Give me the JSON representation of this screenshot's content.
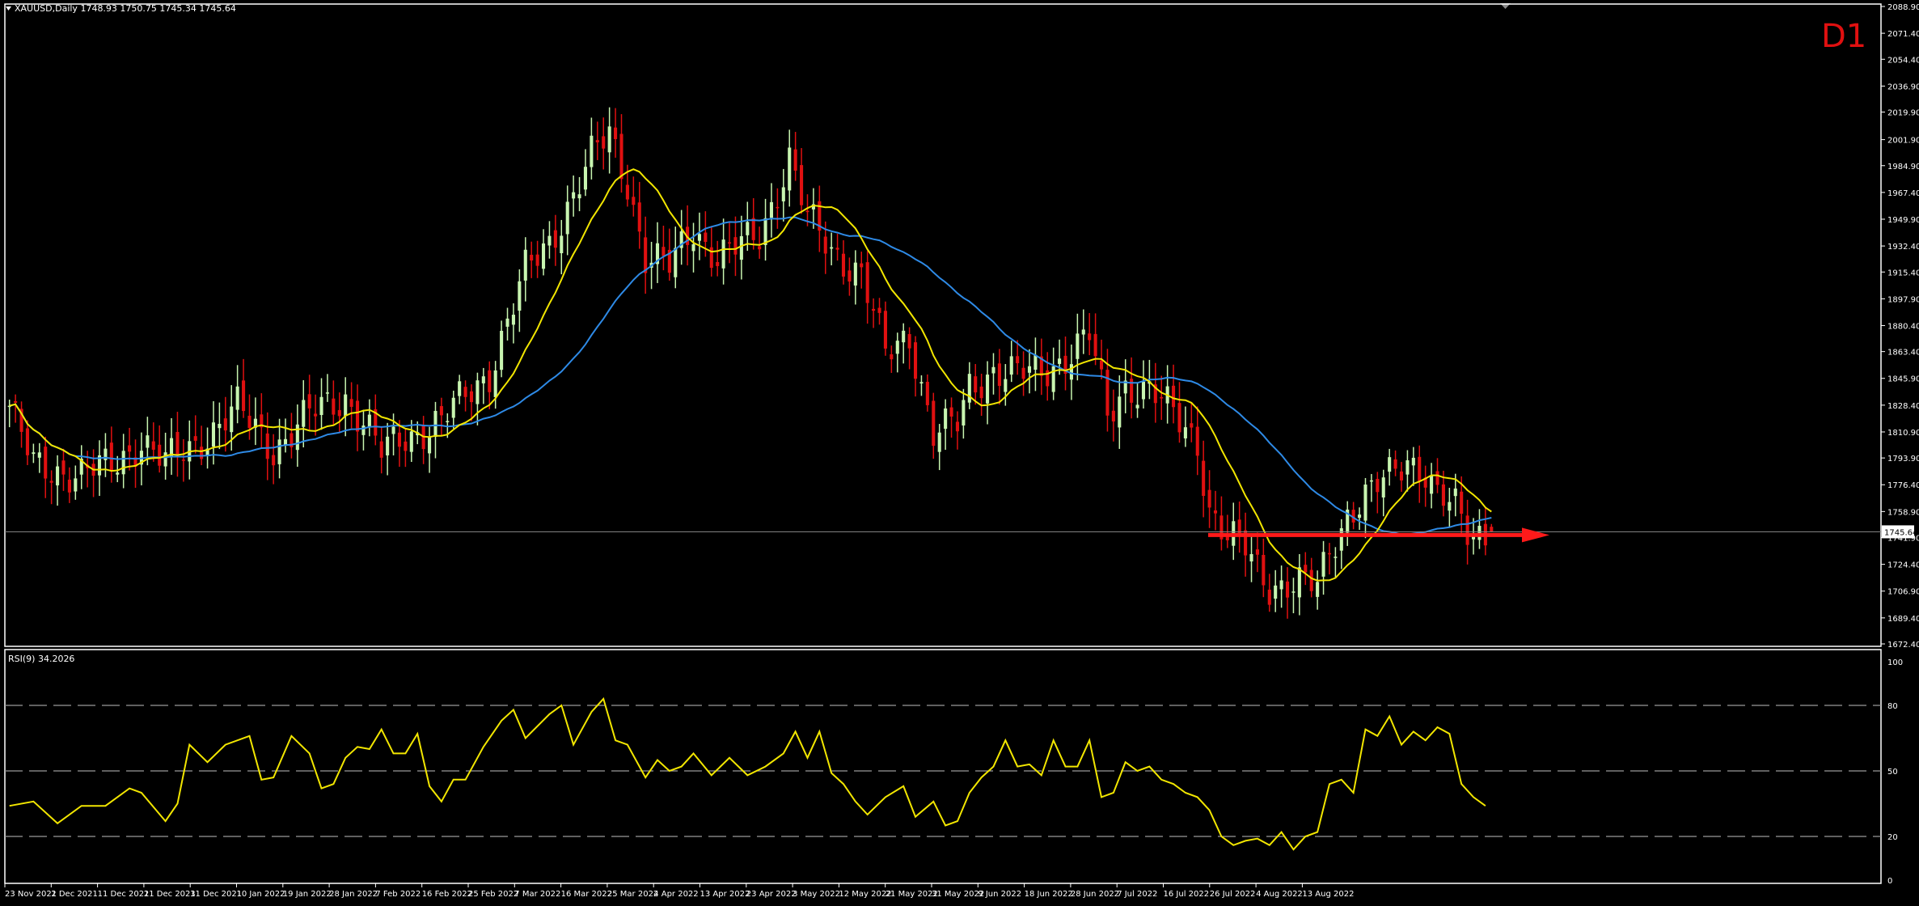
{
  "header": {
    "symbol_info": "XAUUSD,Daily  1748.93 1750.75 1745.34 1745.64",
    "timeframe_label": "D1"
  },
  "main_chart": {
    "price_ticks": [
      "2088.90",
      "2071.40",
      "2054.40",
      "2036.90",
      "2019.90",
      "2001.90",
      "1984.90",
      "1967.40",
      "1949.90",
      "1932.40",
      "1915.40",
      "1897.90",
      "1880.40",
      "1863.40",
      "1845.90",
      "1828.40",
      "1810.90",
      "1793.90",
      "1776.40",
      "1758.90",
      "1741.90",
      "1724.40",
      "1706.90",
      "1689.40",
      "1672.40"
    ],
    "current_price": "1745.64",
    "colors": {
      "bull": "#c8f5b0",
      "bear": "#e01010",
      "ma_fast": "#f2e600",
      "ma_slow": "#2e8ae6",
      "arrow": "#ff1a1a",
      "grid": "#000000",
      "axis": "#ffffff"
    }
  },
  "rsi_panel": {
    "label": "RSI(9) 34.2026",
    "ticks": [
      "100",
      "80",
      "50",
      "20",
      "0"
    ],
    "line_color": "#f2e600"
  },
  "time_axis": {
    "labels": [
      "23 Nov 2021",
      "2 Dec 2021",
      "11 Dec 2021",
      "21 Dec 2021",
      "31 Dec 2021",
      "10 Jan 2022",
      "19 Jan 2022",
      "28 Jan 2022",
      "7 Feb 2022",
      "16 Feb 2022",
      "25 Feb 2022",
      "7 Mar 2022",
      "16 Mar 2022",
      "25 Mar 2022",
      "4 Apr 2022",
      "13 Apr 2022",
      "23 Apr 2022",
      "3 May 2022",
      "12 May 2022",
      "21 May 2022",
      "31 May 2022",
      "9 Jun 2022",
      "18 Jun 2022",
      "28 Jun 2022",
      "7 Jul 2022",
      "16 Jul 2022",
      "26 Jul 2022",
      "4 Aug 2022",
      "13 Aug 2022"
    ]
  },
  "chart_data": {
    "type": "candlestick",
    "symbol": "XAUUSD",
    "timeframe": "Daily",
    "ylim": [
      1672.4,
      2088.9
    ],
    "last": {
      "open": 1748.93,
      "high": 1750.75,
      "low": 1745.34,
      "close": 1745.64
    },
    "anchors_close": [
      [
        0,
        1828
      ],
      [
        4,
        1788
      ],
      [
        12,
        1784
      ],
      [
        17,
        1788
      ],
      [
        22,
        1806
      ],
      [
        26,
        1790
      ],
      [
        30,
        1800
      ],
      [
        38,
        1826
      ],
      [
        44,
        1800
      ],
      [
        50,
        1822
      ],
      [
        56,
        1834
      ],
      [
        59,
        1818
      ],
      [
        62,
        1797
      ],
      [
        66,
        1808
      ],
      [
        72,
        1818
      ],
      [
        80,
        1850
      ],
      [
        86,
        1915
      ],
      [
        90,
        1935
      ],
      [
        97,
        1990
      ],
      [
        100,
        2005
      ],
      [
        103,
        1975
      ],
      [
        106,
        1925
      ],
      [
        110,
        1918
      ],
      [
        114,
        1945
      ],
      [
        118,
        1925
      ],
      [
        121,
        1930
      ],
      [
        125,
        1940
      ],
      [
        130,
        1990
      ],
      [
        133,
        1950
      ],
      [
        137,
        1930
      ],
      [
        142,
        1915
      ],
      [
        146,
        1860
      ],
      [
        150,
        1875
      ],
      [
        154,
        1810
      ],
      [
        158,
        1815
      ],
      [
        160,
        1840
      ],
      [
        164,
        1852
      ],
      [
        168,
        1848
      ],
      [
        172,
        1850
      ],
      [
        176,
        1860
      ],
      [
        180,
        1874
      ],
      [
        183,
        1820
      ],
      [
        186,
        1842
      ],
      [
        190,
        1838
      ],
      [
        194,
        1822
      ],
      [
        198,
        1805
      ],
      [
        200,
        1760
      ],
      [
        203,
        1740
      ],
      [
        206,
        1735
      ],
      [
        210,
        1712
      ],
      [
        214,
        1710
      ],
      [
        218,
        1710
      ],
      [
        220,
        1735
      ],
      [
        223,
        1758
      ],
      [
        227,
        1770
      ],
      [
        230,
        1782
      ],
      [
        233,
        1795
      ],
      [
        236,
        1785
      ],
      [
        238,
        1768
      ],
      [
        241,
        1760
      ],
      [
        243,
        1746
      ]
    ],
    "rsi_anchors": [
      [
        0,
        34
      ],
      [
        4,
        36
      ],
      [
        8,
        26
      ],
      [
        12,
        34
      ],
      [
        16,
        34
      ],
      [
        20,
        42
      ],
      [
        22,
        40
      ],
      [
        26,
        27
      ],
      [
        28,
        35
      ],
      [
        30,
        62
      ],
      [
        33,
        54
      ],
      [
        36,
        62
      ],
      [
        40,
        66
      ],
      [
        42,
        46
      ],
      [
        44,
        47
      ],
      [
        47,
        66
      ],
      [
        50,
        58
      ],
      [
        52,
        42
      ],
      [
        54,
        44
      ],
      [
        56,
        56
      ],
      [
        58,
        61
      ],
      [
        60,
        60
      ],
      [
        62,
        69
      ],
      [
        64,
        58
      ],
      [
        66,
        58
      ],
      [
        68,
        67
      ],
      [
        70,
        43
      ],
      [
        72,
        36
      ],
      [
        74,
        46
      ],
      [
        76,
        46
      ],
      [
        79,
        61
      ],
      [
        82,
        73
      ],
      [
        84,
        78
      ],
      [
        86,
        65
      ],
      [
        90,
        76
      ],
      [
        92,
        80
      ],
      [
        94,
        62
      ],
      [
        97,
        77
      ],
      [
        99,
        83
      ],
      [
        101,
        64
      ],
      [
        103,
        62
      ],
      [
        106,
        47
      ],
      [
        108,
        55
      ],
      [
        110,
        50
      ],
      [
        112,
        52
      ],
      [
        114,
        58
      ],
      [
        117,
        48
      ],
      [
        120,
        56
      ],
      [
        123,
        48
      ],
      [
        126,
        52
      ],
      [
        129,
        58
      ],
      [
        131,
        68
      ],
      [
        133,
        56
      ],
      [
        135,
        68
      ],
      [
        137,
        49
      ],
      [
        139,
        44
      ],
      [
        141,
        36
      ],
      [
        143,
        30
      ],
      [
        146,
        38
      ],
      [
        149,
        43
      ],
      [
        151,
        29
      ],
      [
        154,
        36
      ],
      [
        156,
        25
      ],
      [
        158,
        27
      ],
      [
        160,
        40
      ],
      [
        162,
        47
      ],
      [
        164,
        52
      ],
      [
        166,
        64
      ],
      [
        168,
        52
      ],
      [
        170,
        53
      ],
      [
        172,
        48
      ],
      [
        174,
        64
      ],
      [
        176,
        52
      ],
      [
        178,
        52
      ],
      [
        180,
        64
      ],
      [
        182,
        38
      ],
      [
        184,
        40
      ],
      [
        186,
        54
      ],
      [
        188,
        50
      ],
      [
        190,
        52
      ],
      [
        192,
        46
      ],
      [
        194,
        44
      ],
      [
        196,
        40
      ],
      [
        198,
        38
      ],
      [
        200,
        32
      ],
      [
        202,
        20
      ],
      [
        204,
        16
      ],
      [
        206,
        18
      ],
      [
        208,
        19
      ],
      [
        210,
        16
      ],
      [
        212,
        22
      ],
      [
        214,
        14
      ],
      [
        216,
        20
      ],
      [
        218,
        22
      ],
      [
        220,
        44
      ],
      [
        222,
        46
      ],
      [
        224,
        40
      ],
      [
        226,
        69
      ],
      [
        228,
        66
      ],
      [
        230,
        75
      ],
      [
        232,
        62
      ],
      [
        234,
        68
      ],
      [
        236,
        64
      ],
      [
        238,
        70
      ],
      [
        240,
        67
      ],
      [
        242,
        44
      ],
      [
        244,
        38
      ],
      [
        246,
        34
      ]
    ]
  }
}
